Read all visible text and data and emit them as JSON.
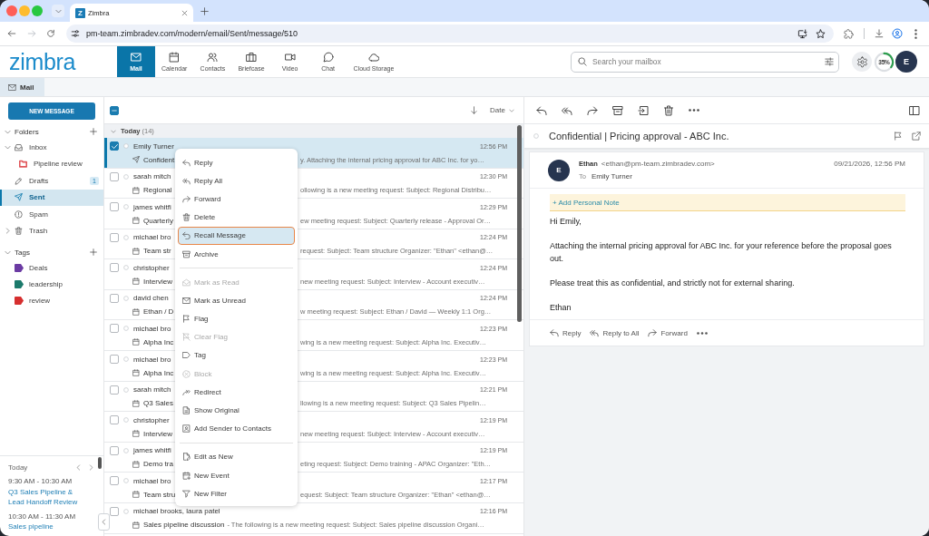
{
  "browser": {
    "tabs": [
      {
        "title": "Zimbra",
        "favicon_text": "Z",
        "selected": true
      }
    ],
    "url": "pm-team.zimbradev.com/modern/email/Sent/message/510"
  },
  "app": {
    "logo": "zimbra",
    "nav": [
      {
        "label": "Mail",
        "selected": true
      },
      {
        "label": "Calendar",
        "selected": false
      },
      {
        "label": "Contacts",
        "selected": false
      },
      {
        "label": "Briefcase",
        "selected": false
      },
      {
        "label": "Video",
        "selected": false
      },
      {
        "label": "Chat",
        "selected": false
      },
      {
        "label": "Cloud Storage",
        "selected": false
      }
    ],
    "search": {
      "placeholder": "Search your mailbox"
    },
    "storage": {
      "reading": "35%",
      "level": 0.35
    },
    "avatar": "E"
  },
  "subheader": {
    "tabs": [
      {
        "label": "Mail",
        "selected": true
      }
    ]
  },
  "sidebar": {
    "new_message": "NEW MESSAGE",
    "folders": {
      "title": "Folders",
      "expanded": true,
      "items": [
        {
          "label": "Inbox",
          "kind": "inbox",
          "expanded": true,
          "selected": false,
          "children": [
            {
              "label": "Pipeline review",
              "kind": "folder",
              "color": "#e0575b",
              "selected": false
            }
          ]
        },
        {
          "label": "Drafts",
          "kind": "drafts",
          "badge": "1",
          "selected": false
        },
        {
          "label": "Sent",
          "kind": "sent",
          "selected": true
        },
        {
          "label": "Spam",
          "kind": "spam",
          "selected": false
        },
        {
          "label": "Trash",
          "kind": "trash",
          "expanded": false,
          "selected": false
        }
      ]
    },
    "tags": {
      "title": "Tags",
      "expanded": true,
      "items": [
        {
          "label": "Deals",
          "color": "#6b3ba3"
        },
        {
          "label": "leadership",
          "color": "#1c7a6c"
        },
        {
          "label": "review",
          "color": "#d62f2f"
        }
      ]
    },
    "agenda": {
      "title": "Today",
      "events": [
        {
          "time": "9:30 AM - 10:30 AM",
          "title": "Q3 Sales Pipeline & Lead Handoff Review"
        },
        {
          "time": "10:30 AM - 11:30 AM",
          "title": "Sales pipeline"
        }
      ]
    }
  },
  "message_list": {
    "select_all": {
      "indeterminate": true
    },
    "sort": {
      "label": "Date"
    },
    "groups": [
      {
        "label": "Today",
        "count": "(14)",
        "expanded": true,
        "messages": [
          {
            "sender": "Emily Turner",
            "subject": "Confident",
            "preview": "y. Attaching the internal pricing approval for ABC Inc. for yo…",
            "time": "12:56 PM",
            "kind": "sent",
            "checked": true,
            "selected": true,
            "partly_hidden": true
          },
          {
            "sender": "sarah mitch",
            "subject": "Regional",
            "preview": "ollowing is a new meeting request: Subject: Regional Distribu…",
            "time": "12:30 PM",
            "kind": "meeting",
            "checked": false,
            "selected": false,
            "partly_hidden": true
          },
          {
            "sender": "james whitfi",
            "subject": "Quarterly",
            "preview": "ew meeting request: Subject: Quarterly release - Approval Or…",
            "time": "12:29 PM",
            "kind": "meeting",
            "checked": false,
            "selected": false,
            "partly_hidden": true
          },
          {
            "sender": "michael bro",
            "subject": "Team str",
            "preview": "request: Subject: Team structure Organizer: \"Ethan\" <ethan@…",
            "time": "12:24 PM",
            "kind": "meeting",
            "checked": false,
            "selected": false,
            "partly_hidden": true
          },
          {
            "sender": "christopher",
            "subject": "Interview",
            "preview": "new meeting request: Subject: Interview - Account executiv…",
            "time": "12:24 PM",
            "kind": "meeting",
            "checked": false,
            "selected": false,
            "partly_hidden": true
          },
          {
            "sender": "david chen",
            "subject": "Ethan / D",
            "preview": "w meeting request: Subject: Ethan / David — Weekly 1:1 Org…",
            "time": "12:24 PM",
            "kind": "meeting",
            "checked": false,
            "selected": false,
            "partly_hidden": true
          },
          {
            "sender": "michael bro",
            "subject": "Alpha Inc",
            "preview": "wing is a new meeting request: Subject: Alpha Inc. Executiv…",
            "time": "12:23 PM",
            "kind": "meeting",
            "checked": false,
            "selected": false,
            "partly_hidden": true
          },
          {
            "sender": "michael bro",
            "subject": "Alpha Inc",
            "preview": "wing is a new meeting request: Subject: Alpha Inc. Executiv…",
            "time": "12:23 PM",
            "kind": "meeting",
            "checked": false,
            "selected": false,
            "partly_hidden": true
          },
          {
            "sender": "sarah mitch",
            "subject": "Q3 Sales",
            "preview": "llowing is a new meeting request: Subject: Q3 Sales Pipelin…",
            "time": "12:21 PM",
            "kind": "meeting",
            "checked": false,
            "selected": false,
            "partly_hidden": true
          },
          {
            "sender": "christopher",
            "subject": "Interview",
            "preview": "new meeting request: Subject: Interview - Account executiv…",
            "time": "12:19 PM",
            "kind": "meeting",
            "checked": false,
            "selected": false,
            "partly_hidden": true
          },
          {
            "sender": "james whitfi",
            "subject": "Demo tra",
            "preview": "eting request: Subject: Demo training - APAC Organizer: \"Eth…",
            "time": "12:19 PM",
            "kind": "meeting",
            "checked": false,
            "selected": false,
            "partly_hidden": true
          },
          {
            "sender": "michael bro",
            "subject": "Team stru",
            "preview": "equest: Subject: Team structure Organizer: \"Ethan\" <ethan@…",
            "time": "12:17 PM",
            "kind": "meeting",
            "checked": false,
            "selected": false,
            "partly_hidden": true
          },
          {
            "sender": "michael brooks, laura patel",
            "subject": "Sales pipeline discussion",
            "preview": "- The following is a new meeting request: Subject: Sales pipeline discussion Organi…",
            "time": "12:16 PM",
            "kind": "meeting",
            "checked": false,
            "selected": false,
            "partly_hidden": false
          }
        ]
      }
    ]
  },
  "context_menu": {
    "sections": [
      {
        "items": [
          {
            "label": "Reply",
            "disabled": false,
            "highlighted": false
          },
          {
            "label": "Reply All",
            "disabled": false,
            "highlighted": false
          },
          {
            "label": "Forward",
            "disabled": false,
            "highlighted": false
          },
          {
            "label": "Delete",
            "disabled": false,
            "highlighted": false
          },
          {
            "label": "Recall Message",
            "disabled": false,
            "highlighted": true
          },
          {
            "label": "Archive",
            "disabled": false,
            "highlighted": false
          }
        ]
      },
      {
        "items": [
          {
            "label": "Mark as Read",
            "disabled": true,
            "highlighted": false
          },
          {
            "label": "Mark as Unread",
            "disabled": false,
            "highlighted": false
          },
          {
            "label": "Flag",
            "disabled": false,
            "highlighted": false
          },
          {
            "label": "Clear Flag",
            "disabled": true,
            "highlighted": false
          },
          {
            "label": "Tag",
            "disabled": false,
            "highlighted": false
          },
          {
            "label": "Block",
            "disabled": true,
            "highlighted": false
          },
          {
            "label": "Redirect",
            "disabled": false,
            "highlighted": false
          },
          {
            "label": "Show Original",
            "disabled": false,
            "highlighted": false
          },
          {
            "label": "Add Sender to Contacts",
            "disabled": false,
            "highlighted": false
          }
        ]
      },
      {
        "items": [
          {
            "label": "Edit as New",
            "disabled": false,
            "highlighted": false
          },
          {
            "label": "New Event",
            "disabled": false,
            "highlighted": false
          },
          {
            "label": "New Filter",
            "disabled": false,
            "highlighted": false
          }
        ]
      }
    ]
  },
  "reading_pane": {
    "subject": "Confidential | Pricing approval - ABC Inc.",
    "message": {
      "avatar": "E",
      "from_name": "Ethan",
      "from_email": "<ethan@pm-team.zimbradev.com>",
      "to_label": "To",
      "to": "Emily Turner",
      "date": "09/21/2026, 12:56 PM",
      "note_link": "+ Add Personal Note",
      "body": [
        "Hi Emily,",
        "Attaching the internal pricing approval for ABC Inc. for your reference before the proposal goes out.",
        "Please treat this as confidential, and strictly not for external sharing.",
        "Ethan"
      ],
      "actions": [
        {
          "label": "Reply"
        },
        {
          "label": "Reply to All"
        },
        {
          "label": "Forward"
        }
      ]
    }
  }
}
